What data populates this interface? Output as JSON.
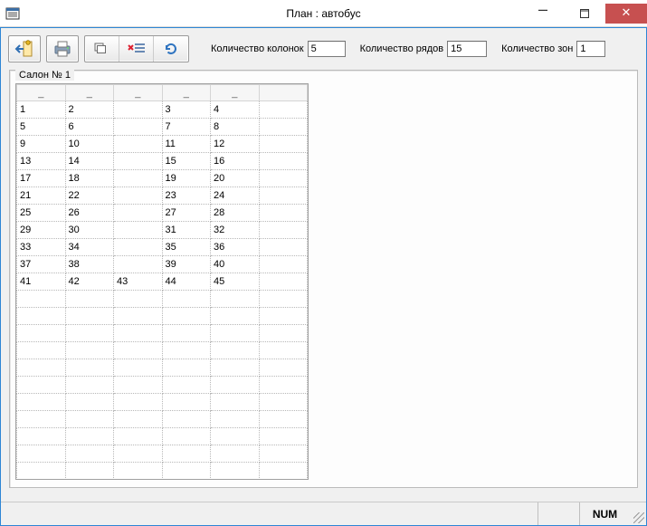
{
  "window": {
    "title": "План : автобус"
  },
  "toolbar": {
    "columns_label": "Количество колонок",
    "columns_value": "5",
    "rows_label": "Количество рядов",
    "rows_value": "15",
    "zones_label": "Количество зон",
    "zones_value": "1"
  },
  "group": {
    "caption": "Салон № 1"
  },
  "grid": {
    "headers": [
      "_",
      "_",
      "_",
      "_",
      "_",
      ""
    ],
    "rows": [
      [
        "1",
        "2",
        "",
        "3",
        "4",
        ""
      ],
      [
        "5",
        "6",
        "",
        "7",
        "8",
        ""
      ],
      [
        "9",
        "10",
        "",
        "11",
        "12",
        ""
      ],
      [
        "13",
        "14",
        "",
        "15",
        "16",
        ""
      ],
      [
        "17",
        "18",
        "",
        "19",
        "20",
        ""
      ],
      [
        "21",
        "22",
        "",
        "23",
        "24",
        ""
      ],
      [
        "25",
        "26",
        "",
        "27",
        "28",
        ""
      ],
      [
        "29",
        "30",
        "",
        "31",
        "32",
        ""
      ],
      [
        "33",
        "34",
        "",
        "35",
        "36",
        ""
      ],
      [
        "37",
        "38",
        "",
        "39",
        "40",
        ""
      ],
      [
        "41",
        "42",
        "43",
        "44",
        "45",
        ""
      ],
      [
        "",
        "",
        "",
        "",
        "",
        ""
      ],
      [
        "",
        "",
        "",
        "",
        "",
        ""
      ],
      [
        "",
        "",
        "",
        "",
        "",
        ""
      ],
      [
        "",
        "",
        "",
        "",
        "",
        ""
      ],
      [
        "",
        "",
        "",
        "",
        "",
        ""
      ],
      [
        "",
        "",
        "",
        "",
        "",
        ""
      ],
      [
        "",
        "",
        "",
        "",
        "",
        ""
      ],
      [
        "",
        "",
        "",
        "",
        "",
        ""
      ],
      [
        "",
        "",
        "",
        "",
        "",
        ""
      ],
      [
        "",
        "",
        "",
        "",
        "",
        ""
      ],
      [
        "",
        "",
        "",
        "",
        "",
        ""
      ]
    ]
  },
  "status": {
    "num": "NUM"
  }
}
